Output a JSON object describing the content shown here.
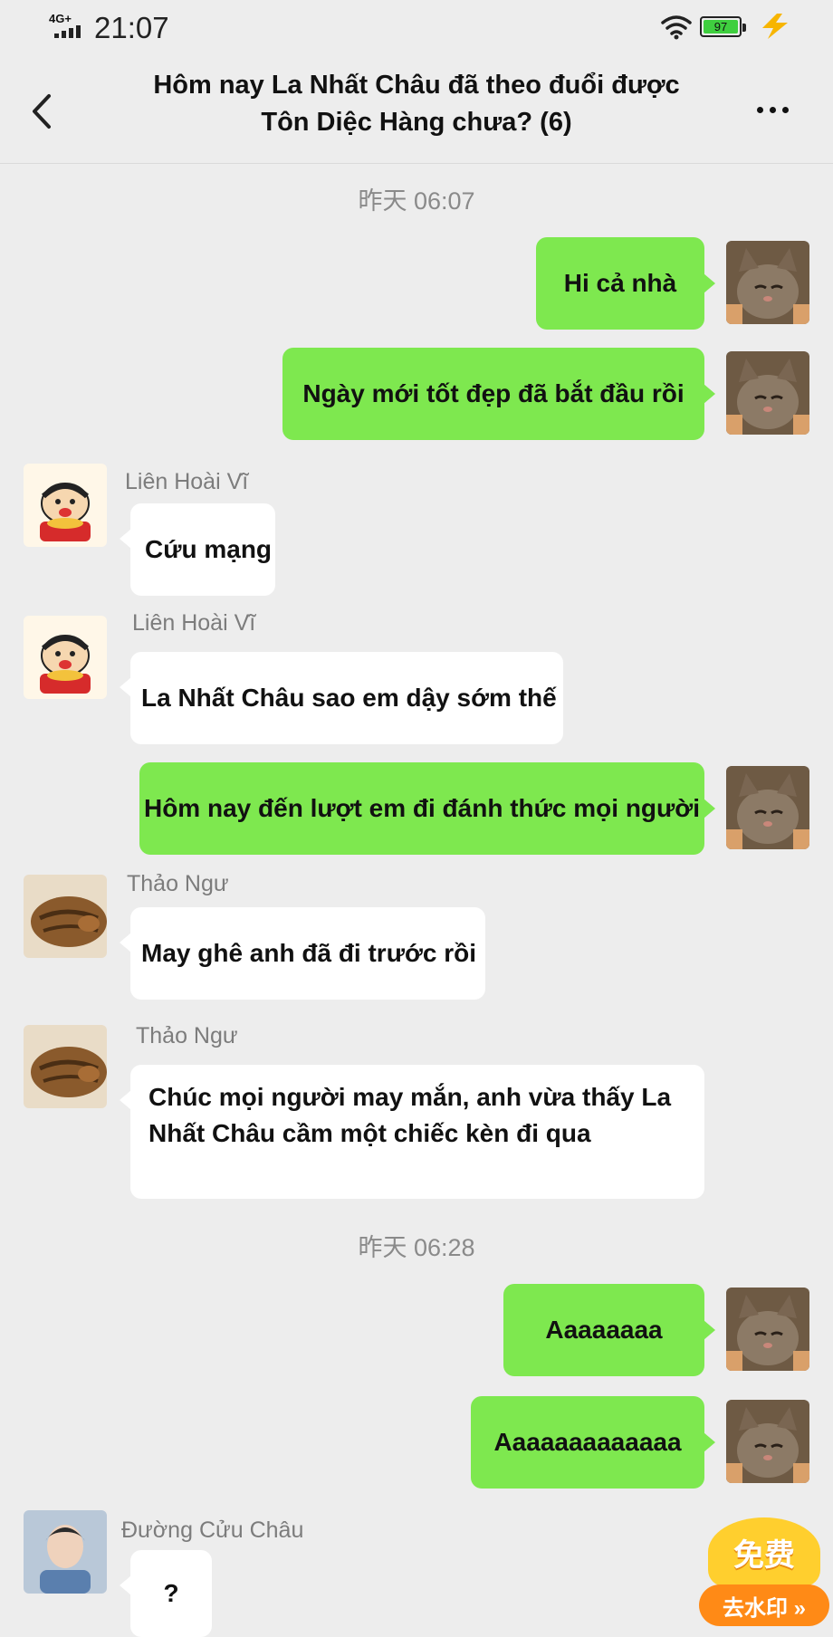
{
  "status_bar": {
    "network": "4G+",
    "time": "21:07",
    "battery": "97"
  },
  "header": {
    "title_line1": "Hôm nay La Nhất Châu đã theo đuổi được",
    "title_line2": "Tôn Diệc Hàng chưa?  (6)"
  },
  "chat": {
    "timestamp_1": "昨天 06:07",
    "timestamp_2": "昨天 06:28",
    "messages": [
      {
        "text": "Hi cả nhà"
      },
      {
        "text": "Ngày mới tốt đẹp đã bắt đầu rồi"
      },
      {
        "sender": "Liên Hoài Vĩ",
        "text": "Cứu mạng"
      },
      {
        "sender": "Liên Hoài Vĩ",
        "text": "La Nhất Châu sao em dậy sớm thế"
      },
      {
        "text": "Hôm nay đến lượt em đi đánh thức mọi người"
      },
      {
        "sender": "Thảo Ngư",
        "text": "May ghê anh đã đi trước rồi"
      },
      {
        "sender": "Thảo Ngư",
        "text": "Chúc mọi người may mắn, anh vừa thấy La Nhất Châu cầm một chiếc kèn đi qua"
      },
      {
        "text": "Aaaaaaaa"
      },
      {
        "text": "Aaaaaaaaaaaaa"
      },
      {
        "sender": "Đường Cửu Châu",
        "text": "?"
      }
    ]
  },
  "watermark_badge": {
    "top": "免费",
    "bottom": "去水印 »"
  },
  "colors": {
    "outgoing_bubble": "#7ee84f",
    "incoming_bubble": "#ffffff",
    "background": "#ededed"
  }
}
